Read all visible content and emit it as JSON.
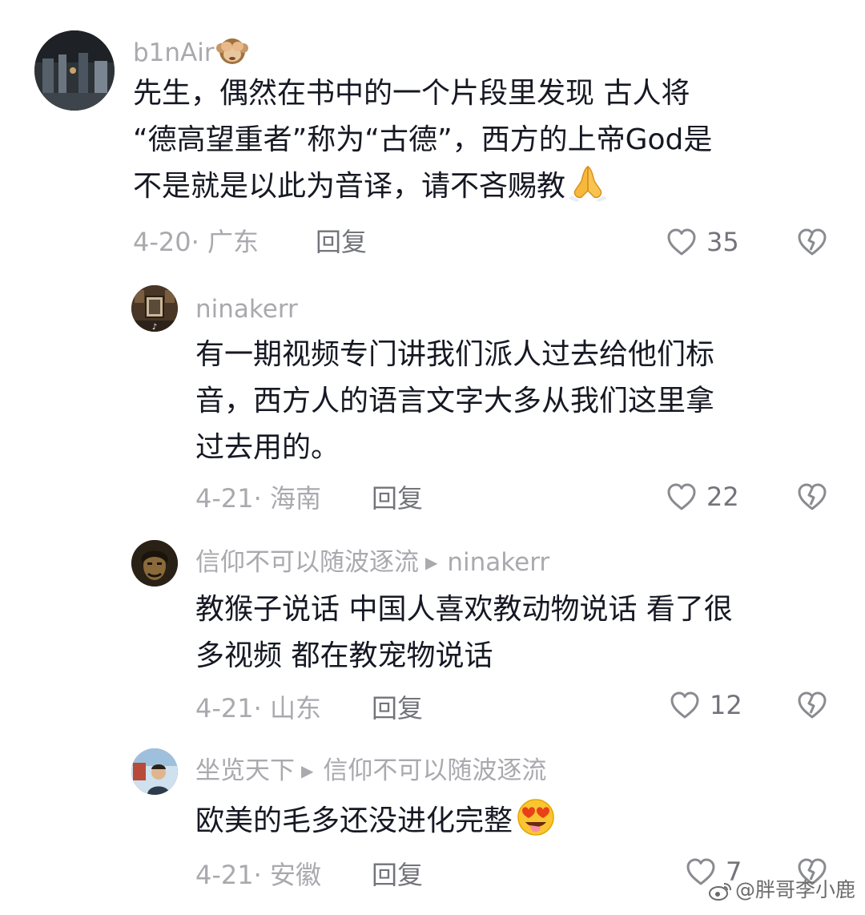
{
  "comments": [
    {
      "username": "b1nAir",
      "username_emoji": "see-no-evil-monkey-emoji",
      "text_lines": [
        "先生，偶然在书中的一个片段里发现 古人将",
        "“德高望重者”称为“古德”，西方的上帝God是",
        "不是就是以此为音译，请不吝赐教"
      ],
      "text_emoji": "folded-hands-emoji",
      "date_location": "4-20· 广东",
      "reply_label": "回复",
      "likes": "35"
    },
    {
      "username": "ninakerr",
      "text_lines": [
        "有一期视频专门讲我们派人过去给他们标",
        "音，西方人的语言文字大多从我们这里拿",
        "过去用的。"
      ],
      "date_location": "4-21· 海南",
      "reply_label": "回复",
      "likes": "22"
    },
    {
      "username": "信仰不可以随波逐流",
      "reply_to": "ninakerr",
      "text_lines": [
        "教猴子说话 中国人喜欢教动物说话 看了很",
        "多视频 都在教宠物说话"
      ],
      "date_location": "4-21· 山东",
      "reply_label": "回复",
      "likes": "12"
    },
    {
      "username": "坐览天下",
      "reply_to": "信仰不可以随波逐流",
      "text_lines": [
        "欧美的毛多还没进化完整"
      ],
      "text_emoji": "heart-eyes-tongue-emoji",
      "date_location": "4-21· 安徽",
      "reply_label": "回复",
      "likes": "7"
    }
  ],
  "watermark": "@胖哥李小鹿",
  "colors": {
    "text": "#161823",
    "secondary": "#a9a9ae",
    "action": "#73747b",
    "background": "#ffffff"
  }
}
